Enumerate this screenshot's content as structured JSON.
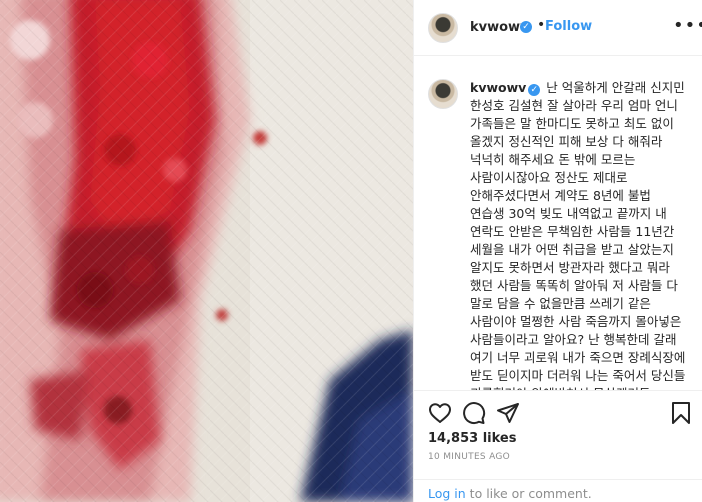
{
  "post": {
    "username": "kvwowv",
    "follow_label": "Follow",
    "more_label": "•••",
    "separator": "•",
    "verified_mark": "✓"
  },
  "caption": {
    "username": "kvwowv",
    "text": "난 억울하게 안갈래 신지민 한성호 김설현 잘 살아라 우리 엄마 언니 가족들은 말 한마디도 못하고 최도 없이 올겠지 정신적인 피해 보상 다 해줘라 넉넉히 해주세요 돈 밖에 모르는 사람이시잖아요 정산도 제대로 안해주셨다면서 계약도 8년에 불법 연습생 30억 빚도 내역없고 끝까지 내 연락도 안받은 무책임한 사람들 11년간 세월을 내가 어떤 취급을 받고 살았는지 알지도 못하면서 방관자라 했다고 뭐라 했던 사람들 똑똑히 알아둬 저 사람들 다 말로 담을 수 없을만큼 쓰레기 같은 사람이야 멀쩡한 사람 죽음까지 몰아넣은 사람들이라고 알아요? 난 행복한데 갈래 여기 너무 괴로워 내가 죽으면 장례식장에 받도 딛이지마 더러워 나는 죽어서 당신들 괴롭힐거야 악에받쳐서 못살겠거든"
  },
  "actions": {
    "like_icon": "heart-outline-icon",
    "comment_icon": "speech-bubble-icon",
    "share_icon": "paper-plane-icon",
    "save_icon": "bookmark-icon"
  },
  "stats": {
    "likes": "14,853 likes",
    "time_ago": "10 MINUTES AGO"
  },
  "footer": {
    "login_link": "Log in",
    "login_suffix": " to like or comment."
  },
  "colors": {
    "accent": "#3897f0",
    "text": "#262626",
    "muted": "#8e8e8e",
    "border": "#efefef"
  }
}
